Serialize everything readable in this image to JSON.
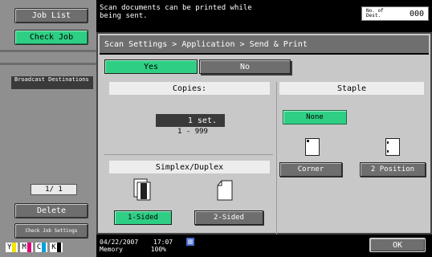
{
  "sidebar": {
    "job_list_label": "Job List",
    "check_job_label": "Check Job",
    "broadcast_label": "Broadcast Destinations",
    "page_indicator": "1/ 1",
    "delete_label": "Delete",
    "check_job_settings_label": "Check Job Settings",
    "toner": [
      {
        "letter": "Y",
        "color": "#f5e400"
      },
      {
        "letter": "M",
        "color": "#e0007a"
      },
      {
        "letter": "C",
        "color": "#00a0e0"
      },
      {
        "letter": "K",
        "color": "#000000"
      }
    ]
  },
  "header": {
    "message": "Scan documents can be printed while being sent.",
    "dest_label": "No. of Dest.",
    "dest_count": "000"
  },
  "main": {
    "breadcrumb": "Scan Settings > Application > Send & Print",
    "yes_label": "Yes",
    "no_label": "No",
    "copies": {
      "title": "Copies:",
      "value": "1 set.",
      "range": "1  -  999"
    },
    "staple": {
      "title": "Staple",
      "none_label": "None",
      "corner_label": "Corner",
      "two_position_label": "2 Position"
    },
    "duplex": {
      "title": "Simplex/Duplex",
      "one_sided_label": "1-Sided",
      "two_sided_label": "2-Sided"
    }
  },
  "status": {
    "date": "04/22/2007",
    "time": "17:07",
    "memory_label": "Memory",
    "memory_value": "100%",
    "ok_label": "OK"
  },
  "colors": {
    "accent_green": "#2ecf84",
    "button_grey": "#6e6e6e",
    "panel_grey": "#c8c8c8"
  }
}
